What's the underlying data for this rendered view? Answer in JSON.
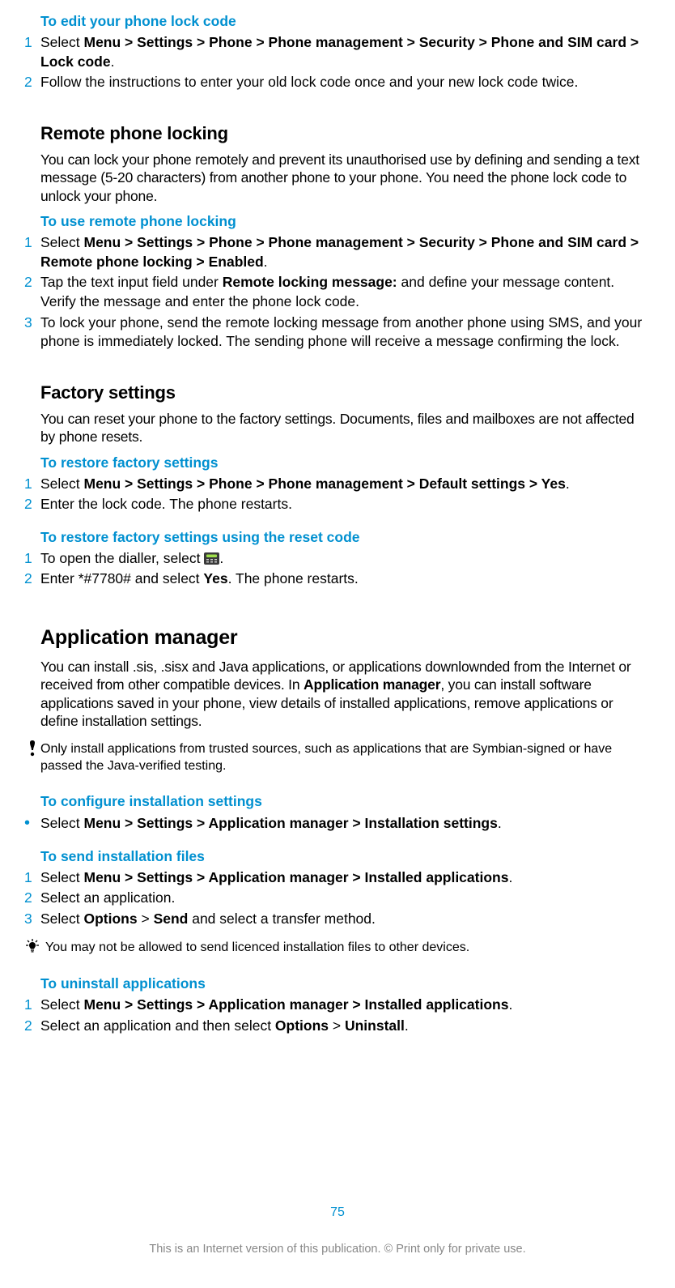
{
  "edit_lock": {
    "title": "To edit your phone lock code",
    "steps": [
      {
        "n": "1",
        "pre": "Select ",
        "path": "Menu > Settings > Phone > Phone management > Security > Phone and SIM card > Lock code",
        "post": "."
      },
      {
        "n": "2",
        "text": "Follow the instructions to enter your old lock code once and your new lock code twice."
      }
    ]
  },
  "remote": {
    "heading": "Remote phone locking",
    "intro": "You can lock your phone remotely and prevent its unauthorised use by defining and sending a text message (5-20 characters) from another phone to your phone. You need the phone lock code to unlock your phone.",
    "proc_title": "To use remote phone locking",
    "steps": [
      {
        "n": "1",
        "pre": "Select ",
        "path": "Menu > Settings > Phone > Phone management > Security > Phone and SIM card > Remote phone locking > Enabled",
        "post": "."
      },
      {
        "n": "2",
        "pre": "Tap the text input field under ",
        "bold": "Remote locking message:",
        "post": " and define your message content. Verify the message and enter the phone lock code."
      },
      {
        "n": "3",
        "text": "To lock your phone, send the remote locking message from another phone using SMS, and your phone is immediately locked. The sending phone will receive a message confirming the lock."
      }
    ]
  },
  "factory": {
    "heading": "Factory settings",
    "intro": "You can reset your phone to the factory settings. Documents, files and mailboxes are not affected by phone resets.",
    "proc1_title": "To restore factory settings",
    "proc1_steps": [
      {
        "n": "1",
        "pre": "Select ",
        "path": "Menu > Settings > Phone > Phone management > Default settings > Yes",
        "post": "."
      },
      {
        "n": "2",
        "text": "Enter the lock code. The phone restarts."
      }
    ],
    "proc2_title": "To restore factory settings using the reset code",
    "proc2_steps": [
      {
        "n": "1",
        "pre": "To open the dialler, select ",
        "icon": "dialler-icon",
        "post": "."
      },
      {
        "n": "2",
        "pre": "Enter *#7780# and select ",
        "bold": "Yes",
        "post": ". The phone restarts."
      }
    ]
  },
  "appmgr": {
    "heading": "Application manager",
    "intro_pre": "You can install .sis, .sisx and Java applications, or applications downlownded from the Internet or received from other compatible devices. In ",
    "intro_bold": "Application manager",
    "intro_post": ", you can install software applications saved in your phone, view details of installed applications, remove applications or define installation settings.",
    "warn": "Only install applications from trusted sources, such as applications that are Symbian-signed or have passed the Java-verified testing.",
    "proc1_title": "To configure installation settings",
    "proc1_bullet": {
      "pre": "Select ",
      "path": "Menu > Settings > Application manager > Installation settings",
      "post": "."
    },
    "proc2_title": "To send installation files",
    "proc2_steps": [
      {
        "n": "1",
        "pre": "Select ",
        "path": "Menu > Settings > Application manager > Installed applications",
        "post": "."
      },
      {
        "n": "2",
        "text": "Select an application."
      },
      {
        "n": "3",
        "pre": "Select ",
        "b1": "Options",
        "mid": " > ",
        "b2": "Send",
        "post": " and select a transfer method."
      }
    ],
    "tip": "You may not be allowed to send licenced installation files to other devices.",
    "proc3_title": "To uninstall applications",
    "proc3_steps": [
      {
        "n": "1",
        "pre": "Select ",
        "path": "Menu > Settings > Application manager > Installed applications",
        "post": "."
      },
      {
        "n": "2",
        "pre": "Select an application and then select ",
        "b1": "Options",
        "mid": " > ",
        "b2": "Uninstall",
        "post": "."
      }
    ]
  },
  "footer": {
    "page": "75",
    "note": "This is an Internet version of this publication. © Print only for private use."
  }
}
